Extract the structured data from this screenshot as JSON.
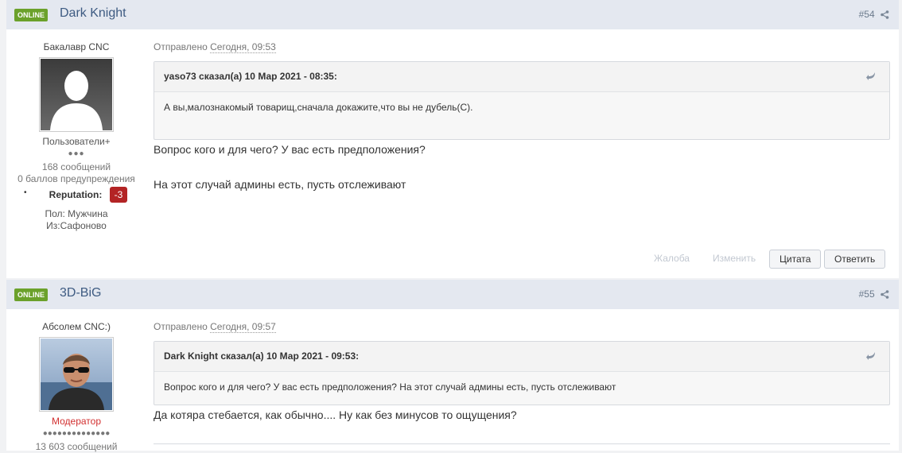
{
  "posts": [
    {
      "status": "ONLINE",
      "author": "Dark Knight",
      "number": "#54",
      "rank_title": "Бакалавр CNC",
      "group": "Пользователи+",
      "rank_dots": "●●●",
      "post_count": "168 сообщений",
      "warnings": "0 баллов предупреждения",
      "reputation_label": "Reputation:",
      "reputation_value": "-3",
      "gender": "Пол: Мужчина",
      "location": "Из:Сафоново",
      "posted_label": "Отправлено",
      "posted_time": "Сегодня, 09:53",
      "quote_header": "yaso73 сказал(а) 10 Мар 2021 - 08:35:",
      "quote_text": "А вы,малознакомый товарищ,сначала докажите,что вы не дубель(С).",
      "body_lines": [
        "Вопрос кого и для чего? У вас есть предположения?",
        "На этот случай админы есть, пусть отслеживают"
      ],
      "actions": {
        "report": "Жалоба",
        "edit": "Изменить",
        "quote": "Цитата",
        "reply": "Ответить"
      }
    },
    {
      "status": "ONLINE",
      "author": "3D-BiG",
      "number": "#55",
      "rank_title": "Абсолем CNC:)",
      "group": "Модератор",
      "rank_dots": "●●●●●●●●●●●●●●",
      "post_count": "13 603 сообщений",
      "posted_label": "Отправлено",
      "posted_time": "Сегодня, 09:57",
      "quote_header": "Dark Knight сказал(а) 10 Мар 2021 - 09:53:",
      "quote_text": "Вопрос кого и для чего? У вас есть предположения? На этот случай админы есть, пусть отслеживают",
      "body_lines": [
        "Да котяра стебается, как обычно.... Ну как без минусов то ощущения?"
      ]
    }
  ],
  "colors": {
    "online_badge": "#6ba12b",
    "author_link": "#3e5b82",
    "header_bg": "#e4e8f0",
    "reputation_negative": "#b32425",
    "moderator": "#d22f2f"
  }
}
